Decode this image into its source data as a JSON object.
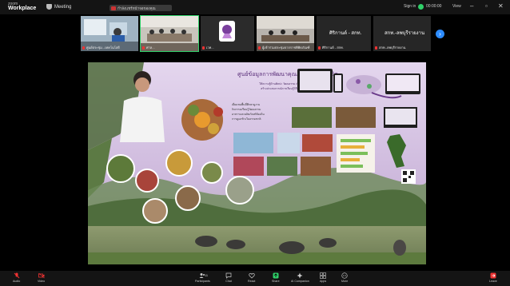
{
  "app": {
    "logo_top": "zoom",
    "logo_bottom": "Workplace"
  },
  "meeting": {
    "label": "Meeting"
  },
  "share_pill": {
    "text": "กำลังแชร์หน้าจอของคุณ"
  },
  "top_right": {
    "signin": "Sign in",
    "status": "00:00:00",
    "view": "View"
  },
  "colors": {
    "accent": "#2d8cff",
    "selected_border": "#2fd069",
    "muted_mic": "#e33333",
    "slide_bg": "#d9c9e6"
  },
  "participants": [
    {
      "name": "ศูนย์ประชุม...เทคโนโลยี",
      "muted": true
    },
    {
      "name": "ศาล...",
      "muted": true
    },
    {
      "name": "เวท...",
      "muted": true
    },
    {
      "name": "ผู้เข้าร่วมประชุมจากราชพิพิธภัณฑ์",
      "muted": true
    },
    {
      "name": "ศิริกานต์ - สกท.",
      "muted": true
    },
    {
      "name": "สกท.-ลพบุรีรายงาน",
      "muted": true
    }
  ],
  "text_tiles": [
    {
      "text": "ศิริกานต์ - สกท."
    },
    {
      "text": "สกท.-ลพบุรีรายงาน"
    }
  ],
  "slide": {
    "title": "ศูนย์ข้อมูลการพัฒนาคุณภาพบริบทวิถีชีวิต",
    "subtitle_lines": [
      "ให้ความรู้ด้านศิลปะ วัฒนธรรม เพื่อส่งเสริมการท่องเที่ยว",
      "สร้างประสบการณ์การเรียนรู้วิถีชีวิตท้องถิ่นอย่างยั่งยืน"
    ],
    "bullets": [
      "เยี่ยมชมพื้นที่ศึกษาดูงาน",
      "กิจกรรมเรียนรู้วัฒนธรรม",
      "อาหารและผลิตภัณฑ์ท้องถิ่น",
      "การดูแลช้างในธรรมชาติ"
    ]
  },
  "toolbar": {
    "audio": "Audio",
    "video": "Video",
    "participants": "Participants",
    "participants_count": "11",
    "chat": "Chat",
    "react": "React",
    "share": "Share",
    "ai_companion": "AI Companion",
    "apps": "Apps",
    "more": "More",
    "leave": "Leave"
  }
}
